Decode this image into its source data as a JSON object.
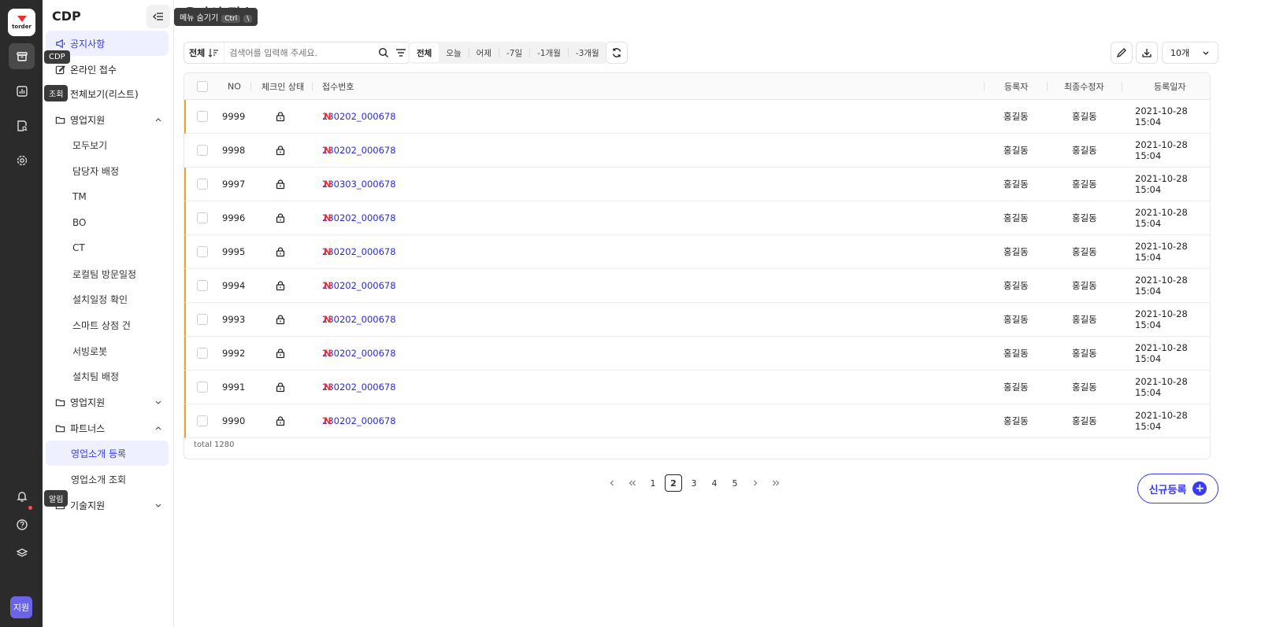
{
  "rail": {
    "brand": "torder",
    "avatar": "지원",
    "tooltips": {
      "cdp": "CDP",
      "view": "조회",
      "alarm": "알림"
    }
  },
  "hide_menu_tooltip": {
    "label": "메뉴 숨기기",
    "key1": "Ctrl",
    "key2": "\\"
  },
  "sidebar": {
    "title": "CDP",
    "items": [
      {
        "label": "공지사항"
      },
      {
        "label": "온라인 접수"
      },
      {
        "label": "전체보기(리스트)"
      },
      {
        "label": "영업지원"
      },
      {
        "label": "모두보기"
      },
      {
        "label": "담당자 배정"
      },
      {
        "label": "TM"
      },
      {
        "label": "BO"
      },
      {
        "label": "CT"
      },
      {
        "label": "로컬팀 방문일정"
      },
      {
        "label": "설치일정 확인"
      },
      {
        "label": "스마트 상점 건"
      },
      {
        "label": "서빙로봇"
      },
      {
        "label": "설치팀 배정"
      },
      {
        "label": "영업지원"
      },
      {
        "label": "파트너스"
      },
      {
        "label": "영업소개 등록"
      },
      {
        "label": "영업소개 조회"
      },
      {
        "label": "기술지원"
      }
    ]
  },
  "main": {
    "title": "온라인 접수",
    "search": {
      "scope": "전체",
      "placeholder": "검색어를 입력해 주세요."
    },
    "ranges": [
      "전체",
      "오늘",
      "어제",
      "-7일",
      "-1개월",
      "-3개월"
    ],
    "page_size": "10개",
    "columns": {
      "no": "NO",
      "status": "체크인 상태",
      "receipt": "접수번호",
      "registrant": "등록자",
      "modifier": "최종수정자",
      "date": "등록일자"
    },
    "rows": [
      {
        "no": "9999",
        "receipt": "230202_000678",
        "badge": "N",
        "registrant": "홍길동",
        "modifier": "홍길동",
        "date": "2021-10-28 15:04"
      },
      {
        "no": "9998",
        "receipt": "230202_000678",
        "badge": "N",
        "registrant": "홍길동",
        "modifier": "홍길동",
        "date": "2021-10-28 15:04"
      },
      {
        "no": "9997",
        "receipt": "230303_000678",
        "badge": "N",
        "registrant": "홍길동",
        "modifier": "홍길동",
        "date": "2021-10-28 15:04"
      },
      {
        "no": "9996",
        "receipt": "230202_000678",
        "badge": "N",
        "registrant": "홍길동",
        "modifier": "홍길동",
        "date": "2021-10-28 15:04"
      },
      {
        "no": "9995",
        "receipt": "230202_000678",
        "badge": "N",
        "registrant": "홍길동",
        "modifier": "홍길동",
        "date": "2021-10-28 15:04"
      },
      {
        "no": "9994",
        "receipt": "230202_000678",
        "badge": "N",
        "registrant": "홍길동",
        "modifier": "홍길동",
        "date": "2021-10-28 15:04"
      },
      {
        "no": "9993",
        "receipt": "230202_000678",
        "badge": "N",
        "registrant": "홍길동",
        "modifier": "홍길동",
        "date": "2021-10-28 15:04"
      },
      {
        "no": "9992",
        "receipt": "230202_000678",
        "badge": "N",
        "registrant": "홍길동",
        "modifier": "홍길동",
        "date": "2021-10-28 15:04"
      },
      {
        "no": "9991",
        "receipt": "230202_000678",
        "badge": "N",
        "registrant": "홍길동",
        "modifier": "홍길동",
        "date": "2021-10-28 15:04"
      },
      {
        "no": "9990",
        "receipt": "230202_000678",
        "badge": "N",
        "registrant": "홍길동",
        "modifier": "홍길동",
        "date": "2021-10-28 15:04"
      }
    ],
    "total": "total 1280",
    "pages": [
      "1",
      "2",
      "3",
      "4",
      "5"
    ],
    "current_page": "2",
    "new_button": "신규등록"
  },
  "colors": {
    "accent": "#3a3aee",
    "badge": "#e8302f",
    "row_marker": "#f0a030"
  }
}
